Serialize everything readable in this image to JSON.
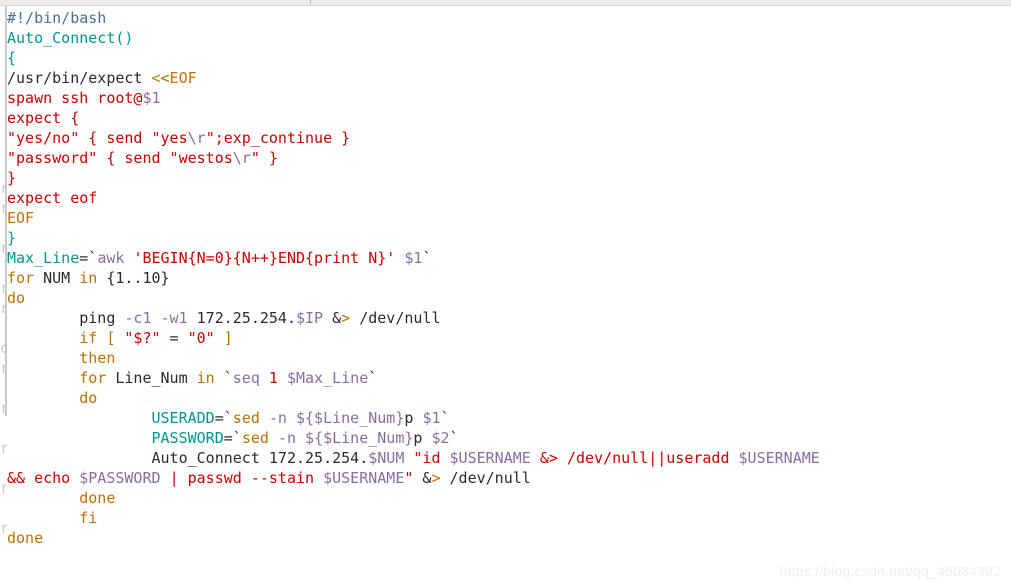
{
  "window": {
    "top_strip_visible": true,
    "background": "#ffffff",
    "gutter_color": "#c9c9c9"
  },
  "colors": {
    "plain": "#2b2b2b",
    "shebang": "#4a6f9c",
    "function": "#009595",
    "variable_assign": "#009595",
    "string": "#cc0000",
    "keyword": "#c07000",
    "heredoc_tag": "#c07000",
    "command": "#8a6d9e",
    "dollar_var": "#8a6d9e",
    "operator": "#c07000",
    "watermark": "#efefef"
  },
  "editor": {
    "language": "bash",
    "font_size_px": 15,
    "line_height_px": 20,
    "total_lines": 29
  },
  "gutter_ghost_chars": [
    "r",
    "r",
    "r",
    "r",
    "r",
    "c",
    "r",
    "r",
    "r",
    "r",
    "r"
  ],
  "code": {
    "lines": [
      {
        "n": 1,
        "tokens": [
          {
            "t": "#!/bin/bash",
            "c": "shebang"
          }
        ]
      },
      {
        "n": 2,
        "tokens": [
          {
            "t": "Auto_Connect()",
            "c": "func"
          }
        ]
      },
      {
        "n": 3,
        "tokens": [
          {
            "t": "{",
            "c": "func"
          }
        ]
      },
      {
        "n": 4,
        "tokens": [
          {
            "t": "/usr/bin/expect ",
            "c": "plain"
          },
          {
            "t": "<<EOF",
            "c": "heredoc"
          }
        ]
      },
      {
        "n": 5,
        "tokens": [
          {
            "t": "spawn ssh root@",
            "c": "str"
          },
          {
            "t": "$1",
            "c": "dollar"
          }
        ]
      },
      {
        "n": 6,
        "tokens": [
          {
            "t": "expect {",
            "c": "str"
          }
        ]
      },
      {
        "n": 7,
        "tokens": [
          {
            "t": "\"yes/no\" { send \"yes",
            "c": "str"
          },
          {
            "t": "\\r",
            "c": "dollar"
          },
          {
            "t": "\";exp_continue }",
            "c": "str"
          }
        ]
      },
      {
        "n": 8,
        "tokens": [
          {
            "t": "\"password\" { send \"westos",
            "c": "str"
          },
          {
            "t": "\\r",
            "c": "dollar"
          },
          {
            "t": "\" }",
            "c": "str"
          }
        ]
      },
      {
        "n": 9,
        "tokens": [
          {
            "t": "}",
            "c": "str"
          }
        ]
      },
      {
        "n": 10,
        "tokens": [
          {
            "t": "expect eof",
            "c": "str"
          }
        ]
      },
      {
        "n": 11,
        "tokens": [
          {
            "t": "EOF",
            "c": "heredoc"
          }
        ]
      },
      {
        "n": 12,
        "tokens": [
          {
            "t": "}",
            "c": "func"
          }
        ]
      },
      {
        "n": 13,
        "tokens": [
          {
            "t": "Max_Line",
            "c": "var"
          },
          {
            "t": "=`",
            "c": "plain"
          },
          {
            "t": "awk ",
            "c": "cmd"
          },
          {
            "t": "'BEGIN{N=0}{N++}END{print N}'",
            "c": "str"
          },
          {
            "t": " ",
            "c": "plain"
          },
          {
            "t": "$1",
            "c": "dollar"
          },
          {
            "t": "`",
            "c": "plain"
          }
        ]
      },
      {
        "n": 14,
        "tokens": [
          {
            "t": "for ",
            "c": "kw"
          },
          {
            "t": "NUM ",
            "c": "plain"
          },
          {
            "t": "in ",
            "c": "kw"
          },
          {
            "t": "{1..10}",
            "c": "plain"
          }
        ]
      },
      {
        "n": 15,
        "tokens": [
          {
            "t": "do",
            "c": "kw"
          }
        ]
      },
      {
        "n": 16,
        "tokens": [
          {
            "t": "        ping ",
            "c": "plain"
          },
          {
            "t": "-c1 -w1",
            "c": "cmd"
          },
          {
            "t": " 172.25.254.",
            "c": "plain"
          },
          {
            "t": "$IP",
            "c": "dollar"
          },
          {
            "t": " &",
            "c": "plain"
          },
          {
            "t": ">",
            "c": "op"
          },
          {
            "t": " /dev/null",
            "c": "plain"
          }
        ]
      },
      {
        "n": 17,
        "tokens": [
          {
            "t": "        ",
            "c": "plain"
          },
          {
            "t": "if ",
            "c": "kw"
          },
          {
            "t": "[ ",
            "c": "kw"
          },
          {
            "t": "\"$?\"",
            "c": "str"
          },
          {
            "t": " = ",
            "c": "plain"
          },
          {
            "t": "\"0\"",
            "c": "str"
          },
          {
            "t": " ]",
            "c": "kw"
          }
        ]
      },
      {
        "n": 18,
        "tokens": [
          {
            "t": "        ",
            "c": "plain"
          },
          {
            "t": "then",
            "c": "kw"
          }
        ]
      },
      {
        "n": 19,
        "tokens": [
          {
            "t": "        ",
            "c": "plain"
          },
          {
            "t": "for ",
            "c": "kw"
          },
          {
            "t": "Line_Num ",
            "c": "plain"
          },
          {
            "t": "in ",
            "c": "kw"
          },
          {
            "t": "`",
            "c": "plain"
          },
          {
            "t": "seq ",
            "c": "cmd"
          },
          {
            "t": "1",
            "c": "num"
          },
          {
            "t": " ",
            "c": "plain"
          },
          {
            "t": "$Max_Line",
            "c": "dollar"
          },
          {
            "t": "`",
            "c": "plain"
          }
        ]
      },
      {
        "n": 20,
        "tokens": [
          {
            "t": "        ",
            "c": "plain"
          },
          {
            "t": "do",
            "c": "kw"
          }
        ]
      },
      {
        "n": 21,
        "tokens": [
          {
            "t": "                ",
            "c": "plain"
          },
          {
            "t": "USERADD",
            "c": "var"
          },
          {
            "t": "=`",
            "c": "plain"
          },
          {
            "t": "sed ",
            "c": "kw"
          },
          {
            "t": "-n ",
            "c": "dollar"
          },
          {
            "t": "${$Line_Num}",
            "c": "dollar"
          },
          {
            "t": "p ",
            "c": "plain"
          },
          {
            "t": "$1",
            "c": "dollar"
          },
          {
            "t": "`",
            "c": "plain"
          }
        ]
      },
      {
        "n": 22,
        "tokens": [
          {
            "t": "                ",
            "c": "plain"
          },
          {
            "t": "PASSWORD",
            "c": "var"
          },
          {
            "t": "=`",
            "c": "plain"
          },
          {
            "t": "sed ",
            "c": "kw"
          },
          {
            "t": "-n ",
            "c": "dollar"
          },
          {
            "t": "${$Line_Num}",
            "c": "dollar"
          },
          {
            "t": "p ",
            "c": "plain"
          },
          {
            "t": "$2",
            "c": "dollar"
          },
          {
            "t": "`",
            "c": "plain"
          }
        ]
      },
      {
        "n": 23,
        "tokens": [
          {
            "t": "                Auto_Connect 172.25.254.",
            "c": "plain"
          },
          {
            "t": "$NUM",
            "c": "dollar"
          },
          {
            "t": " ",
            "c": "plain"
          },
          {
            "t": "\"id ",
            "c": "str"
          },
          {
            "t": "$USERNAME",
            "c": "dollar"
          },
          {
            "t": " ",
            "c": "plain"
          },
          {
            "t": "&> /dev/null||useradd",
            "c": "str"
          },
          {
            "t": " ",
            "c": "plain"
          },
          {
            "t": "$USERNAME",
            "c": "dollar"
          }
        ]
      },
      {
        "n": 24,
        "tokens": [
          {
            "t": "&& echo ",
            "c": "str"
          },
          {
            "t": "$PASSWORD",
            "c": "dollar"
          },
          {
            "t": " ",
            "c": "plain"
          },
          {
            "t": "| ",
            "c": "str"
          },
          {
            "t": "passwd --stain ",
            "c": "str"
          },
          {
            "t": "$USERNAME",
            "c": "dollar"
          },
          {
            "t": "\"",
            "c": "str"
          },
          {
            "t": " &",
            "c": "plain"
          },
          {
            "t": ">",
            "c": "op"
          },
          {
            "t": " /dev/null",
            "c": "plain"
          }
        ]
      },
      {
        "n": 25,
        "tokens": [
          {
            "t": "        ",
            "c": "plain"
          },
          {
            "t": "done",
            "c": "kw"
          }
        ]
      },
      {
        "n": 26,
        "tokens": [
          {
            "t": "        ",
            "c": "plain"
          },
          {
            "t": "fi",
            "c": "kw"
          }
        ]
      },
      {
        "n": 27,
        "tokens": [
          {
            "t": "done",
            "c": "kw"
          }
        ]
      },
      {
        "n": 28,
        "tokens": []
      },
      {
        "n": 29,
        "tokens": []
      }
    ]
  },
  "watermark": {
    "text": "https://blog.csdn.net/qq_45034392"
  }
}
